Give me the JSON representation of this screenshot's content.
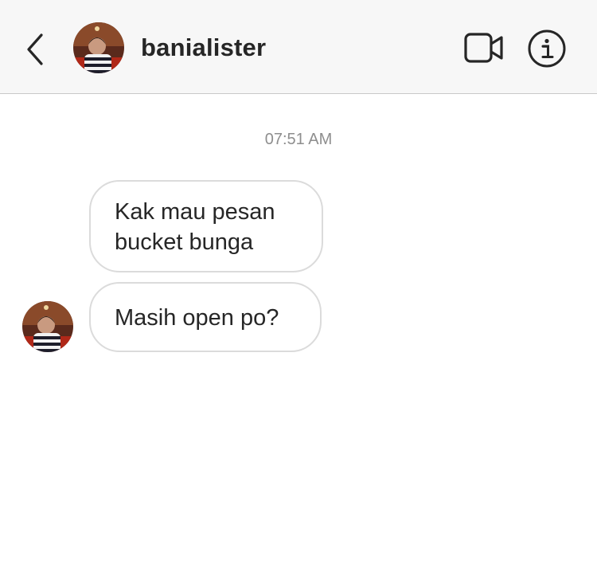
{
  "header": {
    "username": "banialister",
    "icons": {
      "back": "chevron-left-icon",
      "video": "video-camera-icon",
      "info": "info-icon"
    }
  },
  "thread": {
    "timestamp": "07:51 AM",
    "messages": [
      {
        "text": "Kak mau pesan bucket bunga"
      },
      {
        "text": "Masih open po?"
      }
    ]
  },
  "colors": {
    "header_bg": "#f7f7f7",
    "bubble_border": "#dbdbdb",
    "text": "#262626",
    "timestamp": "#8e8e8e"
  }
}
